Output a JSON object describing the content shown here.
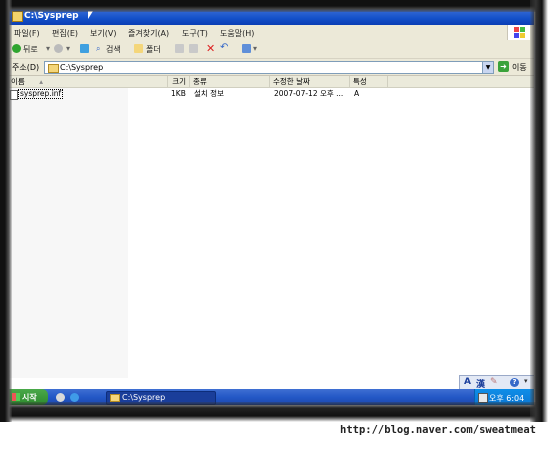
{
  "window": {
    "title": "C:\\Sysprep"
  },
  "menu": [
    "파일(F)",
    "편집(E)",
    "보기(V)",
    "즐겨찾기(A)",
    "도구(T)",
    "도움말(H)"
  ],
  "toolbar": {
    "back": "뒤로",
    "search": "검색",
    "folders": "폴더"
  },
  "address": {
    "label": "주소(D)",
    "path": "C:\\Sysprep",
    "go": "이동"
  },
  "columns": [
    "이름",
    "크기",
    "종류",
    "수정한 날짜",
    "특성"
  ],
  "files": [
    {
      "name": "sysprep.inf",
      "size": "1KB",
      "type": "설치 정보",
      "modified": "2007-07-12 오후 ...",
      "attributes": "A"
    }
  ],
  "langbar": {
    "a": "A",
    "han": "漢"
  },
  "taskbar": {
    "start": "시작",
    "task": "C:\\Sysprep",
    "clock": "오후 6:04"
  },
  "caption": "http://blog.naver.com/sweatmeat",
  "colors": {
    "titlebar": "#1451c9",
    "taskbar": "#2458c6",
    "start": "#2d8a2d"
  }
}
